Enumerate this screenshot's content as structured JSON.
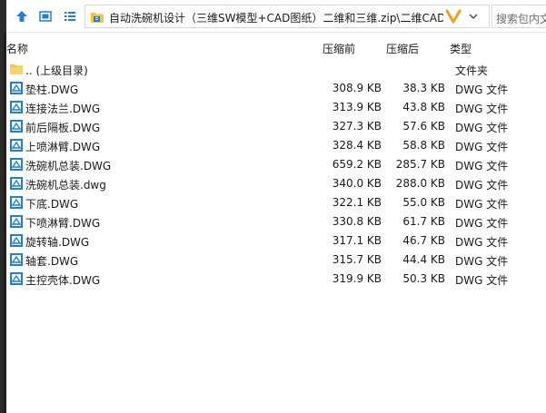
{
  "toolbar": {
    "address_path": "自动洗碗机设计（三维SW模型+CAD图纸）二维和三维.zip\\二维CAD",
    "search_placeholder": "搜索包内文"
  },
  "columns": {
    "name": "名称",
    "original_size": "压缩前",
    "compressed_size": "压缩后",
    "type": "类型"
  },
  "parent_row": {
    "name": ".. (上级目录)",
    "type": "文件夹"
  },
  "files": [
    {
      "name": "垫柱.DWG",
      "original": "308.9 KB",
      "compressed": "38.3 KB",
      "type": "DWG 文件"
    },
    {
      "name": "连接法兰.DWG",
      "original": "313.9 KB",
      "compressed": "43.8 KB",
      "type": "DWG 文件"
    },
    {
      "name": "前后隔板.DWG",
      "original": "327.3 KB",
      "compressed": "57.6 KB",
      "type": "DWG 文件"
    },
    {
      "name": "上喷淋臂.DWG",
      "original": "328.4 KB",
      "compressed": "58.8 KB",
      "type": "DWG 文件"
    },
    {
      "name": "洗碗机总装.DWG",
      "original": "659.2 KB",
      "compressed": "285.7 KB",
      "type": "DWG 文件"
    },
    {
      "name": "洗碗机总装.dwg",
      "original": "340.0 KB",
      "compressed": "288.0 KB",
      "type": "DWG 文件"
    },
    {
      "name": "下底.DWG",
      "original": "322.1 KB",
      "compressed": "55.0 KB",
      "type": "DWG 文件"
    },
    {
      "name": "下喷淋臂.DWG",
      "original": "330.8 KB",
      "compressed": "61.7 KB",
      "type": "DWG 文件"
    },
    {
      "name": "旋转轴.DWG",
      "original": "317.1 KB",
      "compressed": "46.7 KB",
      "type": "DWG 文件"
    },
    {
      "name": "轴套.DWG",
      "original": "315.7 KB",
      "compressed": "44.4 KB",
      "type": "DWG 文件"
    },
    {
      "name": "主控壳体.DWG",
      "original": "319.9 KB",
      "compressed": "50.3 KB",
      "type": "DWG 文件"
    }
  ],
  "colors": {
    "accent_blue": "#1f7ed8",
    "folder_yellow": "#f3c44a",
    "chevron_orange": "#f0a01e"
  },
  "icons": {
    "up": "arrow-up-icon",
    "view_details": "view-details-icon",
    "view_list": "view-list-icon",
    "folder": "folder-icon",
    "chevron": "chevron-icon",
    "dropdown": "dropdown-arrow-icon",
    "dwg": "dwg-file-icon"
  }
}
